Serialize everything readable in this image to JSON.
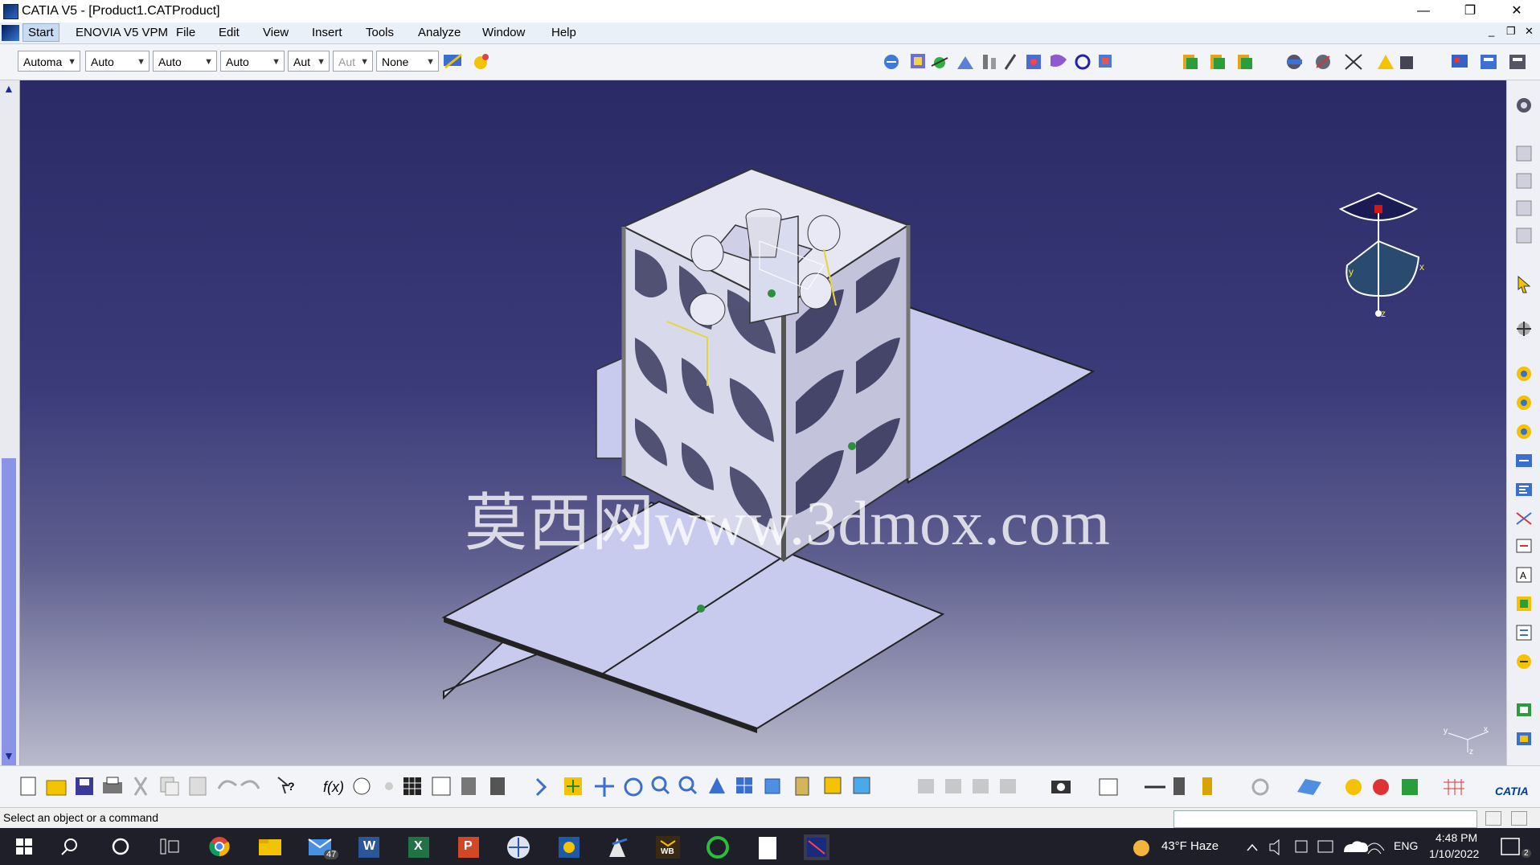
{
  "window": {
    "title": "CATIA V5 - [Product1.CATProduct]",
    "minimize": "—",
    "restore": "❐",
    "close": "✕"
  },
  "menu": {
    "items": [
      "Start",
      "ENOVIA V5 VPM",
      "File",
      "Edit",
      "View",
      "Insert",
      "Tools",
      "Analyze",
      "Window",
      "Help"
    ]
  },
  "toolbar_top": {
    "combos": [
      "Automa",
      "Auto",
      "Auto",
      "Auto",
      "Aut",
      "Aut",
      "None"
    ]
  },
  "viewport": {
    "watermark": "莫西网www.3dmox.com",
    "compass_labels": {
      "x": "x",
      "y": "y",
      "z": "z"
    },
    "axis_labels": {
      "x": "x",
      "y": "y",
      "z": "z"
    }
  },
  "status": {
    "message": "Select an object or a command"
  },
  "taskbar": {
    "weather": "43°F  Haze",
    "mail_badge": "47",
    "word_label": "W",
    "excel_label": "X",
    "ppt_label": "P",
    "wb_label": "WB",
    "language": "ENG",
    "time": "4:48 PM",
    "date": "1/10/2022",
    "notif_count": "2"
  },
  "colors": {
    "viewport_top": "#2a2a66",
    "viewport_bottom": "#b9bacb",
    "part_fill": "#c9cbee",
    "frame": "#e6e7f2"
  }
}
